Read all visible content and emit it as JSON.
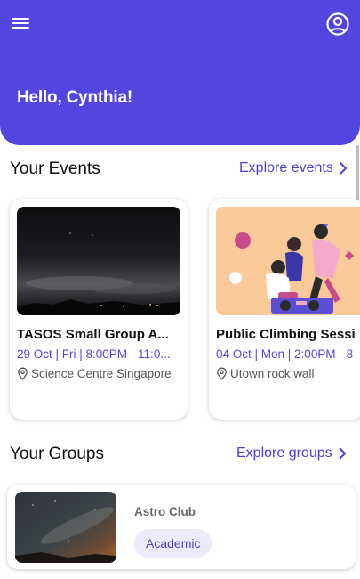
{
  "header": {
    "greeting": "Hello, Cynthia!",
    "menu_icon": "hamburger-menu-icon",
    "account_icon": "account-circle-icon",
    "background_color": "#5146e0"
  },
  "events_section": {
    "title": "Your Events",
    "link_label": "Explore events",
    "link_color": "#4b3fd6",
    "cards": [
      {
        "title": "TASOS Small Group A...",
        "date": "29 Oct | Fri | 8:00PM - 11:0...",
        "location": "Science Centre Singapore"
      },
      {
        "title": "Public Climbing Sessi",
        "date": "04 Oct | Mon | 2:00PM - 8",
        "location": "Utown rock wall"
      }
    ]
  },
  "groups_section": {
    "title": "Your Groups",
    "link_label": "Explore groups",
    "groups": [
      {
        "name": "Astro Club",
        "tag": "Academic"
      }
    ]
  }
}
